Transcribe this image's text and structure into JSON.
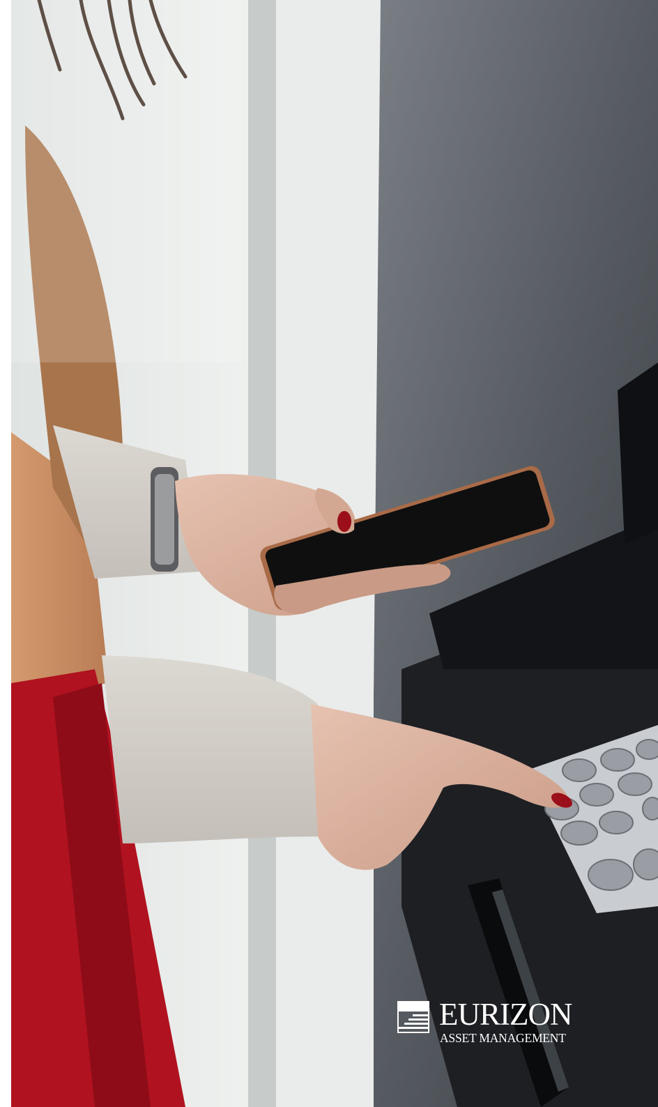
{
  "brand": {
    "name": "EURIZON",
    "tagline": "ASSET MANAGEMENT"
  },
  "photo": {
    "subject": "atm-card-payment-photo"
  },
  "colors": {
    "logo": "#ffffff",
    "sweater": "#cfcac3",
    "dress": "#b0121f",
    "atm_body": "#2a2d31",
    "keypad": "#c9ccd0",
    "window": "#eef1ef"
  }
}
